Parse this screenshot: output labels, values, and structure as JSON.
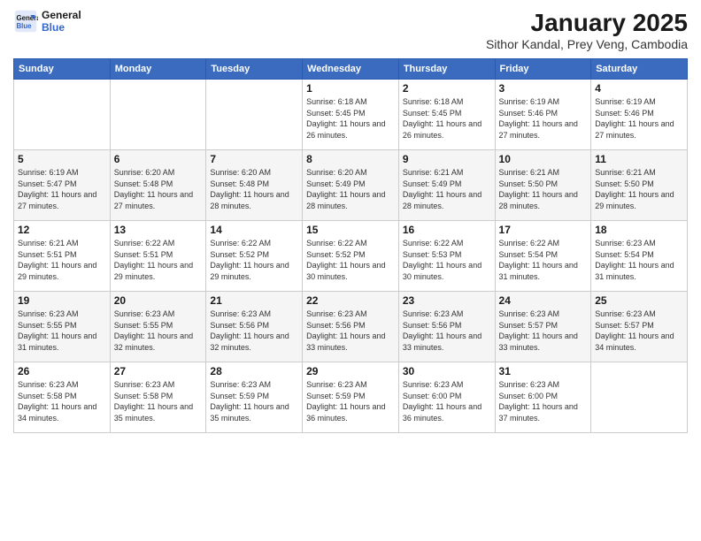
{
  "header": {
    "logo_line1": "General",
    "logo_line2": "Blue",
    "title": "January 2025",
    "subtitle": "Sithor Kandal, Prey Veng, Cambodia"
  },
  "days_of_week": [
    "Sunday",
    "Monday",
    "Tuesday",
    "Wednesday",
    "Thursday",
    "Friday",
    "Saturday"
  ],
  "weeks": [
    [
      {
        "day": "",
        "info": ""
      },
      {
        "day": "",
        "info": ""
      },
      {
        "day": "",
        "info": ""
      },
      {
        "day": "1",
        "info": "Sunrise: 6:18 AM\nSunset: 5:45 PM\nDaylight: 11 hours and 26 minutes."
      },
      {
        "day": "2",
        "info": "Sunrise: 6:18 AM\nSunset: 5:45 PM\nDaylight: 11 hours and 26 minutes."
      },
      {
        "day": "3",
        "info": "Sunrise: 6:19 AM\nSunset: 5:46 PM\nDaylight: 11 hours and 27 minutes."
      },
      {
        "day": "4",
        "info": "Sunrise: 6:19 AM\nSunset: 5:46 PM\nDaylight: 11 hours and 27 minutes."
      }
    ],
    [
      {
        "day": "5",
        "info": "Sunrise: 6:19 AM\nSunset: 5:47 PM\nDaylight: 11 hours and 27 minutes."
      },
      {
        "day": "6",
        "info": "Sunrise: 6:20 AM\nSunset: 5:48 PM\nDaylight: 11 hours and 27 minutes."
      },
      {
        "day": "7",
        "info": "Sunrise: 6:20 AM\nSunset: 5:48 PM\nDaylight: 11 hours and 28 minutes."
      },
      {
        "day": "8",
        "info": "Sunrise: 6:20 AM\nSunset: 5:49 PM\nDaylight: 11 hours and 28 minutes."
      },
      {
        "day": "9",
        "info": "Sunrise: 6:21 AM\nSunset: 5:49 PM\nDaylight: 11 hours and 28 minutes."
      },
      {
        "day": "10",
        "info": "Sunrise: 6:21 AM\nSunset: 5:50 PM\nDaylight: 11 hours and 28 minutes."
      },
      {
        "day": "11",
        "info": "Sunrise: 6:21 AM\nSunset: 5:50 PM\nDaylight: 11 hours and 29 minutes."
      }
    ],
    [
      {
        "day": "12",
        "info": "Sunrise: 6:21 AM\nSunset: 5:51 PM\nDaylight: 11 hours and 29 minutes."
      },
      {
        "day": "13",
        "info": "Sunrise: 6:22 AM\nSunset: 5:51 PM\nDaylight: 11 hours and 29 minutes."
      },
      {
        "day": "14",
        "info": "Sunrise: 6:22 AM\nSunset: 5:52 PM\nDaylight: 11 hours and 29 minutes."
      },
      {
        "day": "15",
        "info": "Sunrise: 6:22 AM\nSunset: 5:52 PM\nDaylight: 11 hours and 30 minutes."
      },
      {
        "day": "16",
        "info": "Sunrise: 6:22 AM\nSunset: 5:53 PM\nDaylight: 11 hours and 30 minutes."
      },
      {
        "day": "17",
        "info": "Sunrise: 6:22 AM\nSunset: 5:54 PM\nDaylight: 11 hours and 31 minutes."
      },
      {
        "day": "18",
        "info": "Sunrise: 6:23 AM\nSunset: 5:54 PM\nDaylight: 11 hours and 31 minutes."
      }
    ],
    [
      {
        "day": "19",
        "info": "Sunrise: 6:23 AM\nSunset: 5:55 PM\nDaylight: 11 hours and 31 minutes."
      },
      {
        "day": "20",
        "info": "Sunrise: 6:23 AM\nSunset: 5:55 PM\nDaylight: 11 hours and 32 minutes."
      },
      {
        "day": "21",
        "info": "Sunrise: 6:23 AM\nSunset: 5:56 PM\nDaylight: 11 hours and 32 minutes."
      },
      {
        "day": "22",
        "info": "Sunrise: 6:23 AM\nSunset: 5:56 PM\nDaylight: 11 hours and 33 minutes."
      },
      {
        "day": "23",
        "info": "Sunrise: 6:23 AM\nSunset: 5:56 PM\nDaylight: 11 hours and 33 minutes."
      },
      {
        "day": "24",
        "info": "Sunrise: 6:23 AM\nSunset: 5:57 PM\nDaylight: 11 hours and 33 minutes."
      },
      {
        "day": "25",
        "info": "Sunrise: 6:23 AM\nSunset: 5:57 PM\nDaylight: 11 hours and 34 minutes."
      }
    ],
    [
      {
        "day": "26",
        "info": "Sunrise: 6:23 AM\nSunset: 5:58 PM\nDaylight: 11 hours and 34 minutes."
      },
      {
        "day": "27",
        "info": "Sunrise: 6:23 AM\nSunset: 5:58 PM\nDaylight: 11 hours and 35 minutes."
      },
      {
        "day": "28",
        "info": "Sunrise: 6:23 AM\nSunset: 5:59 PM\nDaylight: 11 hours and 35 minutes."
      },
      {
        "day": "29",
        "info": "Sunrise: 6:23 AM\nSunset: 5:59 PM\nDaylight: 11 hours and 36 minutes."
      },
      {
        "day": "30",
        "info": "Sunrise: 6:23 AM\nSunset: 6:00 PM\nDaylight: 11 hours and 36 minutes."
      },
      {
        "day": "31",
        "info": "Sunrise: 6:23 AM\nSunset: 6:00 PM\nDaylight: 11 hours and 37 minutes."
      },
      {
        "day": "",
        "info": ""
      }
    ]
  ]
}
